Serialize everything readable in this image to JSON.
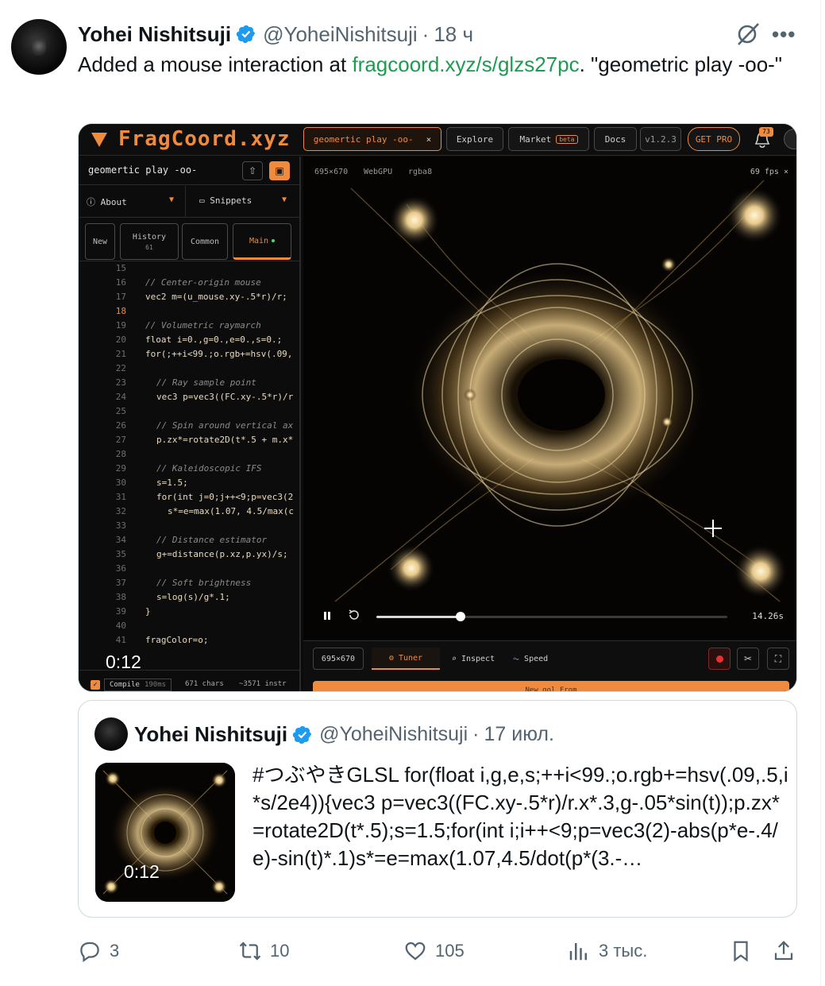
{
  "tweet": {
    "display_name": "Yohei Nishitsuji",
    "handle": "@YoheiNishitsuji",
    "separator": "·",
    "time": "18 ч",
    "text_before": "Added a mouse interaction at ",
    "link": "fragcoord.xyz/s/glzs27pc",
    "text_after": ".  \"geometric play -oo-\"",
    "more": "•••"
  },
  "app": {
    "logo": "FragCoord.xyz",
    "tab_active": "geomertic play -oo-",
    "tab_close": "×",
    "nav": {
      "explore": "Explore",
      "market": "Market",
      "beta": "beta",
      "docs": "Docs",
      "version": "v1.2.3",
      "get_pro": "GET PRO"
    },
    "notifications": "73",
    "doc_title": "geomertic play -oo-",
    "share_icon": "⇧",
    "save_icon": "▣",
    "about": "About",
    "snippets": "Snippets",
    "dropdown_arrow": "▼",
    "tabs": {
      "new": "New",
      "history": "History",
      "history_count": "61",
      "common": "Common",
      "main": "Main"
    },
    "code_lines": [
      {
        "n": "15",
        "t": "",
        "c": false,
        "i": 0
      },
      {
        "n": "16",
        "t": "// Center-origin mouse",
        "c": true,
        "i": 0
      },
      {
        "n": "17",
        "t": "vec2 m=(u_mouse.xy-.5*r)/r;",
        "c": false,
        "i": 0
      },
      {
        "n": "18",
        "t": "",
        "c": false,
        "i": 0
      },
      {
        "n": "19",
        "t": "// Volumetric raymarch",
        "c": true,
        "i": 0
      },
      {
        "n": "20",
        "t": "float i=0.,g=0.,e=0.,s=0.;",
        "c": false,
        "i": 0
      },
      {
        "n": "21",
        "t": "for(;++i<99.;o.rgb+=hsv(.09,",
        "c": false,
        "i": 0
      },
      {
        "n": "22",
        "t": "",
        "c": false,
        "i": 0
      },
      {
        "n": "23",
        "t": "// Ray sample point",
        "c": true,
        "i": 1
      },
      {
        "n": "24",
        "t": "vec3 p=vec3((FC.xy-.5*r)/r",
        "c": false,
        "i": 1
      },
      {
        "n": "25",
        "t": "",
        "c": false,
        "i": 0
      },
      {
        "n": "26",
        "t": "// Spin around vertical ax",
        "c": true,
        "i": 1
      },
      {
        "n": "27",
        "t": "p.zx*=rotate2D(t*.5 + m.x*",
        "c": false,
        "i": 1
      },
      {
        "n": "28",
        "t": "",
        "c": false,
        "i": 0
      },
      {
        "n": "29",
        "t": "// Kaleidoscopic IFS",
        "c": true,
        "i": 1
      },
      {
        "n": "30",
        "t": "s=1.5;",
        "c": false,
        "i": 1
      },
      {
        "n": "31",
        "t": "for(int j=0;j++<9;p=vec3(2",
        "c": false,
        "i": 1
      },
      {
        "n": "32",
        "t": "s*=e=max(1.07, 4.5/max(c",
        "c": false,
        "i": 2
      },
      {
        "n": "33",
        "t": "",
        "c": false,
        "i": 0
      },
      {
        "n": "34",
        "t": "// Distance estimator",
        "c": true,
        "i": 1
      },
      {
        "n": "35",
        "t": "g+=distance(p.xz,p.yx)/s;",
        "c": false,
        "i": 1
      },
      {
        "n": "36",
        "t": "",
        "c": false,
        "i": 0
      },
      {
        "n": "37",
        "t": "// Soft brightness",
        "c": true,
        "i": 1
      },
      {
        "n": "38",
        "t": "s=log(s)/g*.1;",
        "c": false,
        "i": 1
      },
      {
        "n": "39",
        "t": "}",
        "c": false,
        "i": 0
      },
      {
        "n": "40",
        "t": "",
        "c": false,
        "i": 0
      },
      {
        "n": "41",
        "t": "fragColor=o;",
        "c": false,
        "i": 0
      }
    ],
    "current_line": "18",
    "video_time": "0:12",
    "compile": "Compile",
    "compile_ms": "190ms",
    "chars": "671 chars",
    "instr": "~3571 instr",
    "canvas_size": "695×670",
    "backend": "WebGPU",
    "format": "rgba8",
    "fps": "69 fps ×",
    "progress": 0.24,
    "playback_time": "14.26s",
    "bottom_size": "695×670",
    "tuner": "Tuner",
    "inspect": "Inspect",
    "speed": "Speed",
    "orange_bar_text": "New gol From"
  },
  "quote": {
    "display_name": "Yohei Nishitsuji",
    "handle": "@YoheiNishitsuji",
    "separator": "·",
    "date": "17 июл.",
    "video_time": "0:12",
    "text": "#つぶやきGLSL for(float i,g,e,s;++i<99.;o.rgb+=hsv(.09,.5,i*s/2e4)){vec3 p=vec3((FC.xy-.5*r)/r.x*.3,g-.05*sin(t));p.zx*=rotate2D(t*.5);s=1.5;for(int i;i++<9;p=vec3(2)-abs(p*e-.4/e)-sin(t)*.1)s*=e=max(1.07,4.5/dot(p*(3.-…"
  },
  "actions": {
    "replies": "3",
    "reposts": "10",
    "likes": "105",
    "views": "3 тыс."
  },
  "colors": {
    "accent_orange": "#f08a3c",
    "link_green": "#1d9b50",
    "verified_blue": "#1d9bf0",
    "muted": "#536471"
  },
  "icons": [
    "verified-icon",
    "grok-icon",
    "more-icon",
    "reply-icon",
    "repost-icon",
    "like-icon",
    "views-icon",
    "bookmark-icon",
    "share-icon"
  ]
}
